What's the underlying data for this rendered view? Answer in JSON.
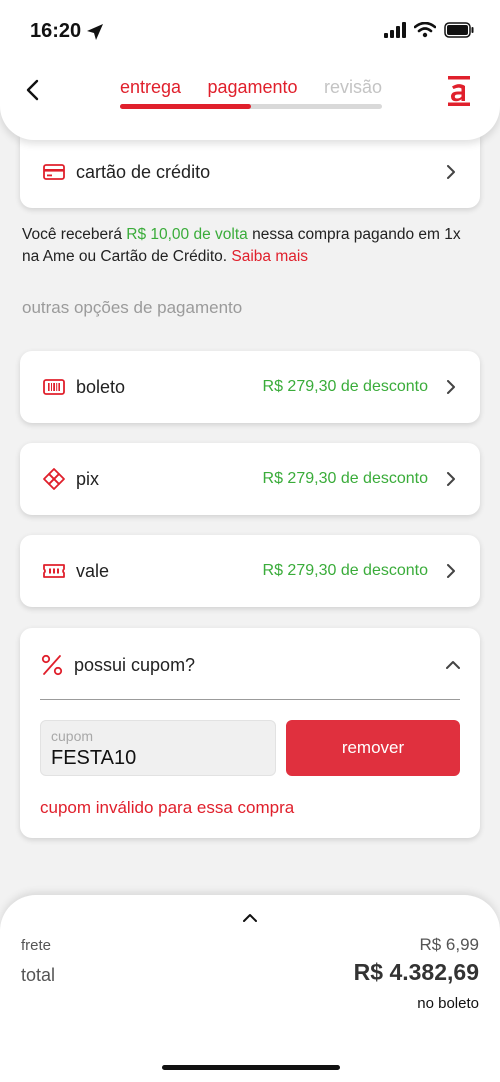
{
  "status": {
    "time": "16:20"
  },
  "header": {
    "steps": [
      "entrega",
      "pagamento",
      "revisão"
    ],
    "progress_fraction": 0.5
  },
  "payment": {
    "credit_card_label": "cartão de crédito",
    "cashback": {
      "prefix": "Você receberá ",
      "amount": "R$ 10,00 de volta",
      "suffix": " nessa compra pagando em 1x na Ame ou Cartão de Crédito. ",
      "link": "Saiba mais"
    },
    "other_options_title": "outras opções de pagamento",
    "options": [
      {
        "label": "boleto",
        "discount": "R$ 279,30 de desconto",
        "icon": "barcode-icon"
      },
      {
        "label": "pix",
        "discount": "R$ 279,30 de desconto",
        "icon": "pix-icon"
      },
      {
        "label": "vale",
        "discount": "R$ 279,30 de desconto",
        "icon": "voucher-icon"
      }
    ]
  },
  "coupon": {
    "title": "possui cupom?",
    "input_label": "cupom",
    "input_value": "FESTA10",
    "remove_label": "remover",
    "error": "cupom inválido para essa compra"
  },
  "footer": {
    "frete_label": "frete",
    "frete_value": "R$ 6,99",
    "total_label": "total",
    "total_value": "R$ 4.382,69",
    "total_note": "no boleto"
  },
  "colors": {
    "accent": "#e0202c",
    "discount_green": "#3aac3a"
  }
}
